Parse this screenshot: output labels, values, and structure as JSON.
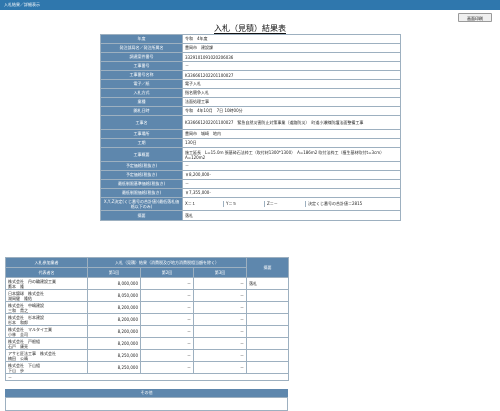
{
  "header": {
    "title": "入札結果／詳細表示"
  },
  "toolbar": {
    "print_label": "画面印刷"
  },
  "page_title": "入札（見積）結果表",
  "info_rows": [
    {
      "label": "年度",
      "value": "令和　4年度"
    },
    {
      "label": "発注部局名／発注所属名",
      "value": "豊岡市　建設課"
    },
    {
      "label": "調達案件番号",
      "value": "3329101091020206036"
    },
    {
      "label": "工事番号",
      "value": "－"
    },
    {
      "label": "工事番号名称",
      "value": "K336661202201100027"
    },
    {
      "label": "電子／紙",
      "value": "電子入札"
    },
    {
      "label": "入札方式",
      "value": "指名競争入札"
    },
    {
      "label": "業種",
      "value": "法面処理工事"
    },
    {
      "label": "開札日時",
      "value": "令和　4年10月　7日 10時00分"
    },
    {
      "label": "工事名",
      "value": "K336661202201100027　緊急自然災害防止対策事業（道路防災）　町道小瀬線防護法面整備工事"
    },
    {
      "label": "工事場所",
      "value": "豊岡市　城崎　地内"
    },
    {
      "label": "工期",
      "value": "130日"
    },
    {
      "label": "工事概要",
      "value": "施工延長　L=15.0ｍ 張基砕石法枠工（吹付材1300*1300）　A=186m2 吹付法枠工（植生基材吹付t=3cm）　A=120m2"
    },
    {
      "label": "予定価格(税抜き)",
      "value": "－"
    },
    {
      "label": "予定価格(税抜き)",
      "value": "￥8,200,000-"
    },
    {
      "label": "最低制限基準価格(税抜き)",
      "value": "－"
    },
    {
      "label": "最低制限価格(税抜き)",
      "value": "￥7,355,000-"
    },
    {
      "label": "X,Y,Z決定(くじ番号の合計値)(最低落札価格以下のみ)",
      "x": "X＝１",
      "y": "Y＝５",
      "z": "Z＝－",
      "note": "決定くじ番号の合計値＝2815"
    },
    {
      "label": "摘要",
      "value": "落札"
    }
  ],
  "bids": {
    "headers": {
      "bidder": "入札参加業者",
      "result_group": "入札（見積）結果（消費税及び地方消費税相当額を除く）",
      "remarks": "摘要",
      "rep": "代表者名",
      "round1": "第1回",
      "round2": "第2回",
      "round3": "第3回"
    },
    "rows": [
      {
        "company": "株式会社　丹の輪建設工業",
        "rep": "鷹本　隆",
        "r1": "8,000,000",
        "r2": "－",
        "r3": "－",
        "note": "落札"
      },
      {
        "company": "日本錦球　株式会社",
        "rep": "湖岡健　隆佑",
        "r1": "8,050,000",
        "r2": "－",
        "r3": "－",
        "note": ""
      },
      {
        "company": "株式会社　中嶋建設",
        "rep": "三和　貴之",
        "r1": "8,200,000",
        "r2": "－",
        "r3": "－",
        "note": ""
      },
      {
        "company": "株式会社　杉本建設",
        "rep": "杉本　和郎",
        "r1": "8,200,000",
        "r2": "－",
        "r3": "－",
        "note": ""
      },
      {
        "company": "株式会社　マルタイ工業",
        "rep": "小林　圭司",
        "r1": "8,200,000",
        "r2": "－",
        "r3": "－",
        "note": ""
      },
      {
        "company": "株式会社　戸根組",
        "rep": "石戸　康亮",
        "r1": "8,200,000",
        "r2": "－",
        "r3": "－",
        "note": ""
      },
      {
        "company": "アサヒ匠法工事　株式会社",
        "rep": "楠田　公晴",
        "r1": "8,250,000",
        "r2": "－",
        "r3": "－",
        "note": ""
      },
      {
        "company": "株式会社　下山組",
        "rep": "下山　歩",
        "r1": "8,250,000",
        "r2": "－",
        "r3": "－",
        "note": ""
      }
    ],
    "footer": "－"
  },
  "other": {
    "title": "その他"
  }
}
